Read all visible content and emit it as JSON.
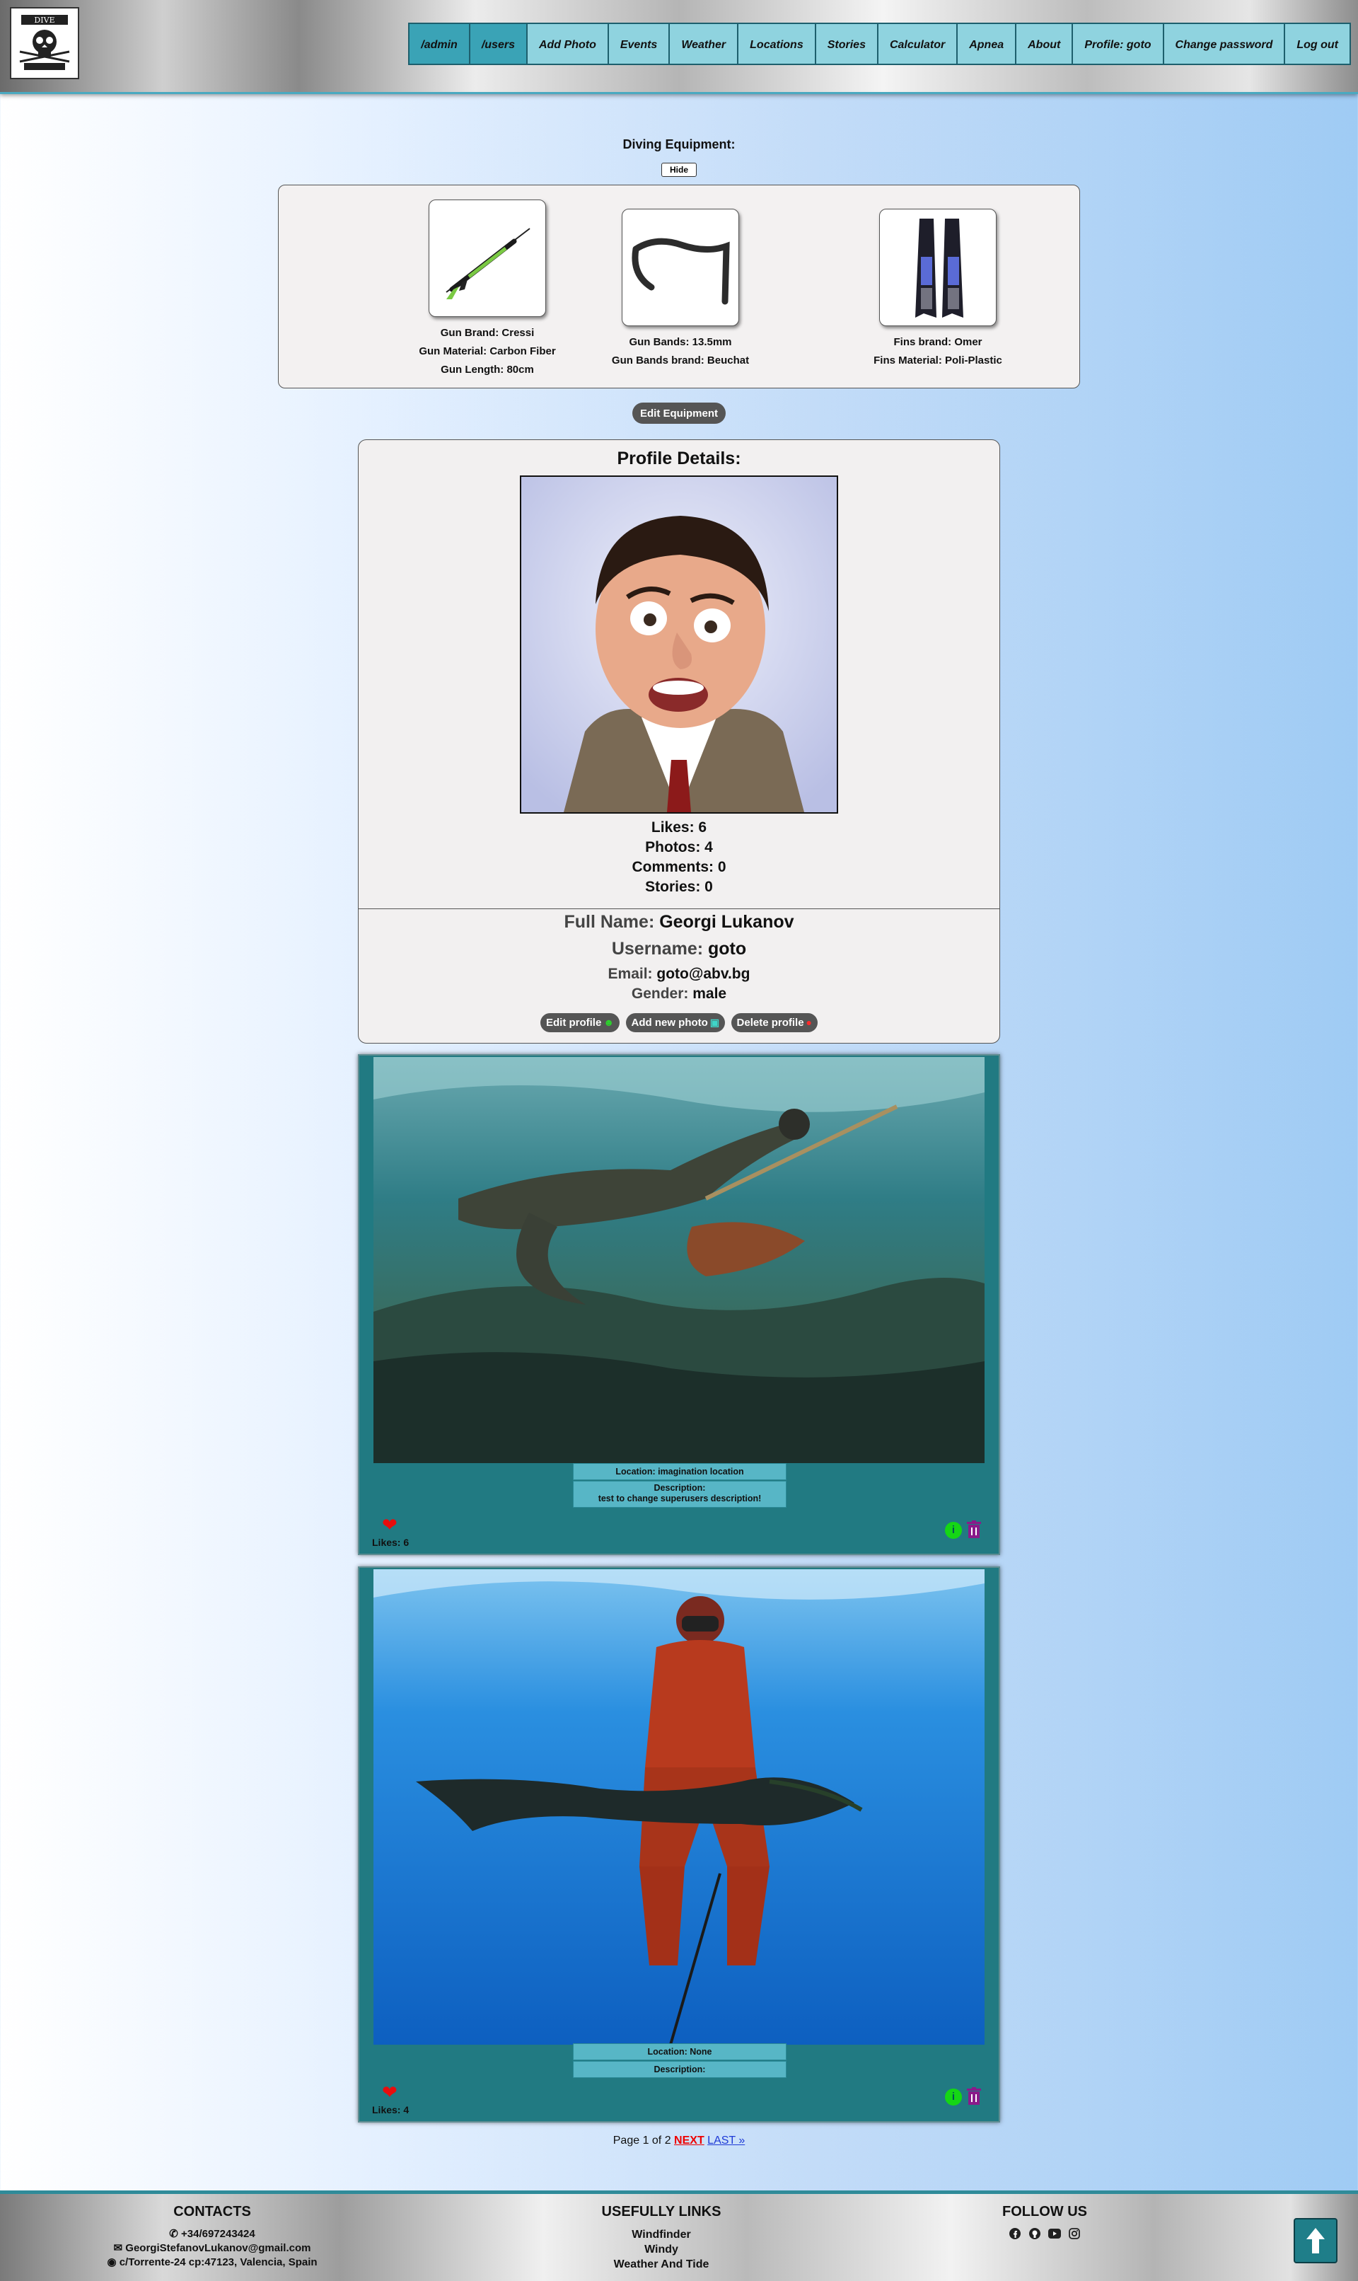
{
  "nav": {
    "items": [
      "/admin",
      "/users",
      "Add Photo",
      "Events",
      "Weather",
      "Locations",
      "Stories",
      "Calculator",
      "Apnea",
      "About",
      "Profile: goto",
      "Change password",
      "Log out"
    ]
  },
  "equipment": {
    "title": "Diving Equipment:",
    "hide_label": "Hide",
    "gun": {
      "brand": "Gun Brand: Cressi",
      "material": "Gun Material: Carbon Fiber",
      "length": "Gun Length: 80cm"
    },
    "bands": {
      "size": "Gun Bands: 13.5mm",
      "brand": "Gun Bands brand: Beuchat"
    },
    "fins": {
      "brand": "Fins brand: Omer",
      "material": "Fins Material: Poli-Plastic"
    },
    "edit_label": "Edit Equipment"
  },
  "profile": {
    "title": "Profile Details:",
    "likes": "Likes: 6",
    "photos": "Photos: 4",
    "comments": "Comments: 0",
    "stories": "Stories: 0",
    "full_name_key": "Full Name:",
    "full_name": "Georgi Lukanov",
    "username_key": "Username:",
    "username": "goto",
    "email_key": "Email:",
    "email": "goto@abv.bg",
    "gender_key": "Gender:",
    "gender": "male",
    "edit_label": "Edit profile",
    "add_photo_label": "Add new photo",
    "delete_label": "Delete profile"
  },
  "photos": [
    {
      "location": "Location: imagination location",
      "description_label": "Description:",
      "description": "test to change superusers description!",
      "likes": "Likes: 6"
    },
    {
      "location": "Location: None",
      "description_label": "Description:",
      "description": "",
      "likes": "Likes: 4"
    }
  ],
  "pager": {
    "text": "Page 1 of 2",
    "next": "NEXT",
    "last": "LAST »"
  },
  "footer": {
    "contacts_title": "CONTACTS",
    "phone": "+34/697243424",
    "email": "GeorgiStefanovLukanov@gmail.com",
    "address": "c/Torrente-24 cp:47123, Valencia, Spain",
    "links_title": "USEFULLY LINKS",
    "links": [
      "Windfinder",
      "Windy",
      "Weather And Tide"
    ],
    "follow_title": "FOLLOW US"
  },
  "colors": {
    "accent": "#217a82",
    "nav": "#8fd3df",
    "like": "#e80d0d"
  }
}
